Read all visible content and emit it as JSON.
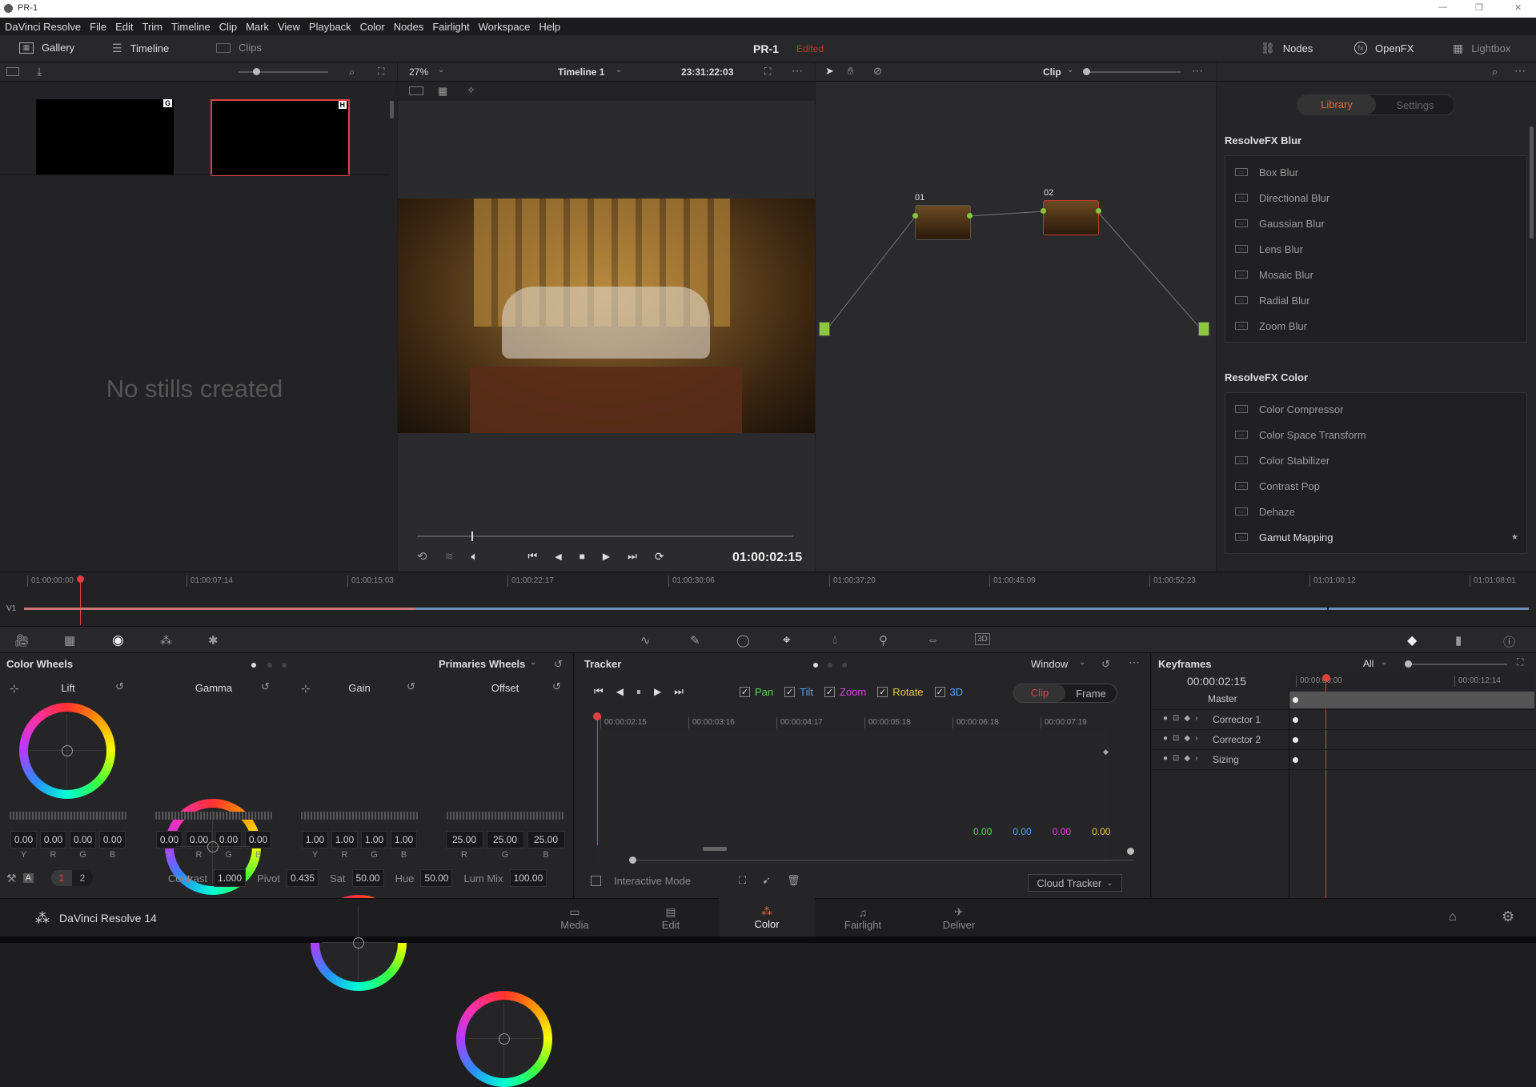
{
  "window": {
    "title": "PR-1",
    "min": "—",
    "max": "❐",
    "close": "✕"
  },
  "menu": [
    "DaVinci Resolve",
    "File",
    "Edit",
    "Trim",
    "Timeline",
    "Clip",
    "Mark",
    "View",
    "Playback",
    "Color",
    "Nodes",
    "Fairlight",
    "Workspace",
    "Help"
  ],
  "toolbar": {
    "gallery": "Gallery",
    "timeline": "Timeline",
    "clips": "Clips",
    "project": "PR-1",
    "status": "Edited",
    "nodes": "Nodes",
    "openfx": "OpenFX",
    "lightbox": "Lightbox"
  },
  "viewer": {
    "zoom": "27%",
    "timeline_name": "Timeline 1",
    "timecode_top": "23:31:22:03",
    "timecode": "01:00:02:15",
    "clip_mode": "Clip"
  },
  "gallery": {
    "empty": "No stills created",
    "stills": [
      {
        "tag": "G"
      },
      {
        "tag": "H"
      }
    ]
  },
  "nodes": [
    {
      "id": "01"
    },
    {
      "id": "02"
    }
  ],
  "fx": {
    "tabs": [
      "Library",
      "Settings"
    ],
    "active": "Library",
    "sections": [
      {
        "title": "ResolveFX Blur",
        "items": [
          "Box Blur",
          "Directional Blur",
          "Gaussian Blur",
          "Lens Blur",
          "Mosaic Blur",
          "Radial Blur",
          "Zoom Blur"
        ]
      },
      {
        "title": "ResolveFX Color",
        "items": [
          "Color Compressor",
          "Color Space Transform",
          "Color Stabilizer",
          "Contrast Pop",
          "Dehaze",
          "Gamut Mapping"
        ]
      }
    ]
  },
  "timeline": {
    "track": "V1",
    "ticks": [
      "01:00:00:00",
      "01:00:07:14",
      "01:00:15:03",
      "01:00:22:17",
      "01:00:30:06",
      "01:00:37:20",
      "01:00:45:09",
      "01:00:52:23",
      "01:01:00:12",
      "01:01:08:01"
    ]
  },
  "color_wheels": {
    "title": "Color Wheels",
    "mode": "Primaries Wheels",
    "wheels": [
      {
        "name": "Lift",
        "values": [
          "0.00",
          "0.00",
          "0.00",
          "0.00"
        ],
        "labels": [
          "Y",
          "R",
          "G",
          "B"
        ]
      },
      {
        "name": "Gamma",
        "values": [
          "0.00",
          "0.00",
          "0.00",
          "0.00"
        ],
        "labels": [
          "Y",
          "R",
          "G",
          "B"
        ]
      },
      {
        "name": "Gain",
        "values": [
          "1.00",
          "1.00",
          "1.00",
          "1.00"
        ],
        "labels": [
          "Y",
          "R",
          "G",
          "B"
        ]
      },
      {
        "name": "Offset",
        "values": [
          "25.00",
          "25.00",
          "25.00"
        ],
        "labels": [
          "R",
          "G",
          "B"
        ]
      }
    ],
    "pages": [
      "1",
      "2"
    ],
    "params": [
      {
        "label": "Contrast",
        "value": "1.000"
      },
      {
        "label": "Pivot",
        "value": "0.435"
      },
      {
        "label": "Sat",
        "value": "50.00"
      },
      {
        "label": "Hue",
        "value": "50.00"
      },
      {
        "label": "Lum Mix",
        "value": "100.00"
      }
    ]
  },
  "tracker": {
    "title": "Tracker",
    "window_mode": "Window",
    "checks": [
      {
        "label": "Pan",
        "color": "#5fd35f"
      },
      {
        "label": "Tilt",
        "color": "#5aa0ff"
      },
      {
        "label": "Zoom",
        "color": "#e040e0"
      },
      {
        "label": "Rotate",
        "color": "#e6c84a"
      },
      {
        "label": "3D",
        "color": "#5aa0ff"
      }
    ],
    "seg": [
      "Clip",
      "Frame"
    ],
    "ticks": [
      "00:00:02:15",
      "00:00:03:16",
      "00:00:04:17",
      "00:00:05:18",
      "00:00:06:18",
      "00:00:07:19"
    ],
    "readouts": [
      {
        "v": "0.00",
        "c": "#5fd35f"
      },
      {
        "v": "0.00",
        "c": "#5aa0ff"
      },
      {
        "v": "0.00",
        "c": "#e040e0"
      },
      {
        "v": "0.00",
        "c": "#e6c84a"
      }
    ],
    "interactive": "Interactive Mode",
    "cloud": "Cloud Tracker"
  },
  "keyframes": {
    "title": "Keyframes",
    "filter": "All",
    "timecode": "00:00:02:15",
    "t1": "00:00:00:00",
    "t2": "00:00:12:14",
    "tracks": [
      "Master",
      "Corrector 1",
      "Corrector 2",
      "Sizing"
    ]
  },
  "pages": {
    "app": "DaVinci Resolve 14",
    "tabs": [
      "Media",
      "Edit",
      "Color",
      "Fairlight",
      "Deliver"
    ],
    "active": "Color"
  }
}
